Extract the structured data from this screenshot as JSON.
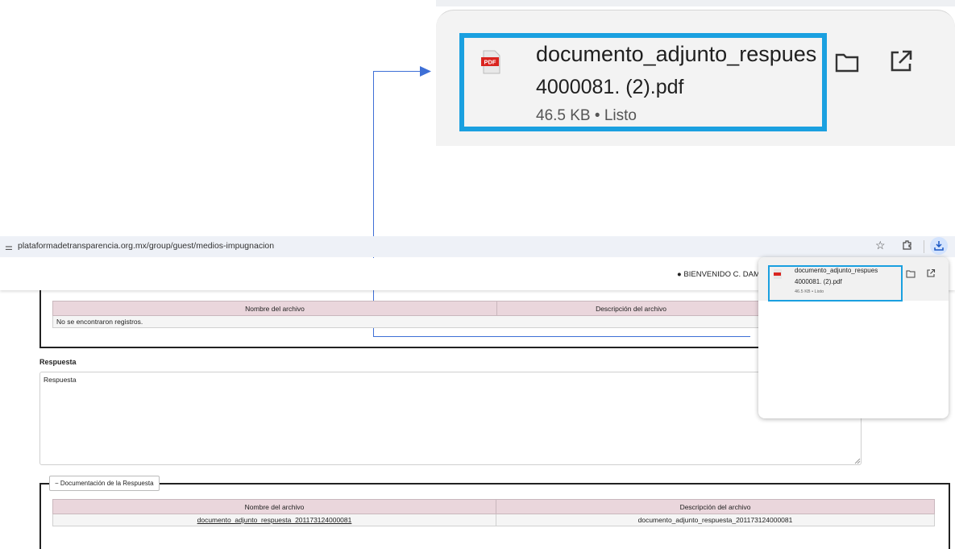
{
  "zoom_popup": {
    "file_name_line1": "documento_adjunto_respues",
    "file_name_line2": "4000081. (2).pdf",
    "meta": "46.5 KB • Listo",
    "pdf_badge": "PDF"
  },
  "browser": {
    "url": "plataformadetransparencia.org.mx/group/guest/medios-impugnacion"
  },
  "header": {
    "welcome": "BIENVENIDO C. DAM"
  },
  "table_top": {
    "columns": [
      "Nombre del archivo",
      "Descripción del archivo"
    ],
    "empty_message": "No se encontraron registros."
  },
  "respuesta": {
    "label": "Respuesta",
    "placeholder": "Respuesta"
  },
  "documentacion": {
    "legend": "− Documentación de la Respuesta",
    "columns": [
      "Nombre del archivo",
      "Descripción del archivo"
    ],
    "rows": [
      {
        "name": "documento_adjunto_respuesta_201173124000081",
        "description": "documento_adjunto_respuesta_201173124000081"
      }
    ]
  },
  "small_popup": {
    "file_name_line1": "documento_adjunto_respues",
    "file_name_line2": "4000081. (2).pdf",
    "meta": "46.5 KB • Listo"
  },
  "colors": {
    "highlight": "#1aa0e0",
    "connector": "#3e6fd6",
    "table_header": "#ead6dc"
  }
}
